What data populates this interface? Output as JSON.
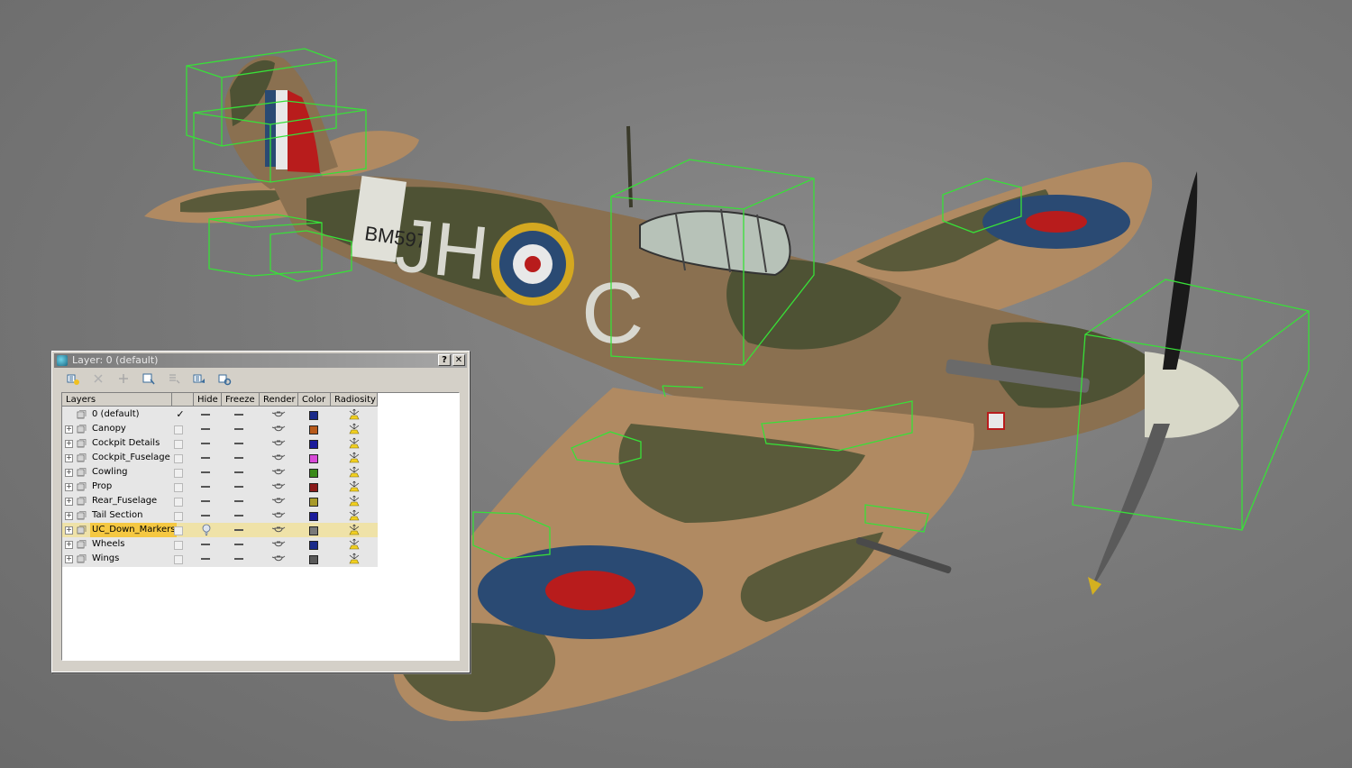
{
  "dialog": {
    "title": "Layer: 0 (default)",
    "help_button": "?",
    "close_button": "✕",
    "toolbar": [
      {
        "name": "create-new-layer-icon",
        "disabled": false
      },
      {
        "name": "delete-layer-icon",
        "disabled": true
      },
      {
        "name": "add-selection-to-layer-icon",
        "disabled": true
      },
      {
        "name": "select-objects-in-layer-icon",
        "disabled": false
      },
      {
        "name": "highlight-selected-layer-icon",
        "disabled": true
      },
      {
        "name": "hide-freeze-all-layers-icon",
        "disabled": false
      },
      {
        "name": "layer-properties-icon",
        "disabled": false
      }
    ],
    "columns": {
      "layers": "Layers",
      "hide": "Hide",
      "freeze": "Freeze",
      "render": "Render",
      "color": "Color",
      "radiosity": "Radiosity"
    },
    "current_mark": "✓",
    "layers": [
      {
        "name": "0 (default)",
        "color": "#1a2a8a",
        "expandable": false,
        "current": true,
        "selected": false,
        "hidden": false
      },
      {
        "name": "Canopy",
        "color": "#b85a1a",
        "expandable": true,
        "current": false,
        "selected": false,
        "hidden": false
      },
      {
        "name": "Cockpit Details",
        "color": "#1a1a9a",
        "expandable": true,
        "current": false,
        "selected": false,
        "hidden": false
      },
      {
        "name": "Cockpit_Fuselage",
        "color": "#d84ad8",
        "expandable": true,
        "current": false,
        "selected": false,
        "hidden": false
      },
      {
        "name": "Cowling",
        "color": "#3a8a1a",
        "expandable": true,
        "current": false,
        "selected": false,
        "hidden": false
      },
      {
        "name": "Prop",
        "color": "#8a1a1a",
        "expandable": true,
        "current": false,
        "selected": false,
        "hidden": false
      },
      {
        "name": "Rear_Fuselage",
        "color": "#a89a2a",
        "expandable": true,
        "current": false,
        "selected": false,
        "hidden": false
      },
      {
        "name": "Tail Section",
        "color": "#1a1a9a",
        "expandable": true,
        "current": false,
        "selected": false,
        "hidden": false
      },
      {
        "name": "UC_Down_Markers",
        "color": "#7a7a7a",
        "expandable": true,
        "current": false,
        "selected": true,
        "hidden": true
      },
      {
        "name": "Wheels",
        "color": "#1a2a8a",
        "expandable": true,
        "current": false,
        "selected": false,
        "hidden": false
      },
      {
        "name": "Wings",
        "color": "#5a5a5a",
        "expandable": true,
        "current": false,
        "selected": false,
        "hidden": false
      }
    ]
  },
  "model_markings": {
    "code_letters": "JH",
    "individual_letter": "C",
    "serial": "BM597"
  }
}
